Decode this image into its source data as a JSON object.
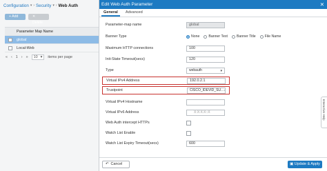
{
  "breadcrumb": {
    "items": [
      "Configuration",
      "Security",
      "Web Auth"
    ],
    "separator": "›"
  },
  "toolbar": {
    "add_label": "+ Add",
    "delete_label": "✕ Delete"
  },
  "table": {
    "header": "Parameter Map Name",
    "rows": [
      "global",
      "Local-Web"
    ]
  },
  "pager": {
    "first": "«",
    "prev": "‹",
    "page": "1",
    "next": "›",
    "last": "»",
    "per_page": "10",
    "per_page_suffix": "items per page"
  },
  "panel": {
    "title": "Edit Web Auth Parameter",
    "close_label": "✕",
    "tabs": [
      "General",
      "Advanced"
    ],
    "fields": {
      "param_map_name": {
        "label": "Parameter-map name",
        "value": "global"
      },
      "banner_type": {
        "label": "Banner Type",
        "options": [
          "None",
          "Banner Text",
          "Banner Title",
          "File Name"
        ],
        "selected": "None"
      },
      "max_http": {
        "label": "Maximum HTTP connections",
        "value": "100"
      },
      "init_state_timeout": {
        "label": "Init-State Timeout(secs)",
        "value": "120"
      },
      "type": {
        "label": "Type",
        "value": "webauth"
      },
      "virtual_ipv4": {
        "label": "Virtual IPv4 Address",
        "value": "192.0.2.1"
      },
      "trustpoint": {
        "label": "Trustpoint",
        "value": "CISCO_IDEVID_SU..."
      },
      "virtual_ipv4_hostname": {
        "label": "Virtual IPv4 Hostname",
        "value": ""
      },
      "virtual_ipv6": {
        "label": "Virtual IPv6 Address",
        "placeholder": "X:X:X:X::X"
      },
      "intercept_https": {
        "label": "Web Auth intercept HTTPs"
      },
      "watch_list_enable": {
        "label": "Watch List Enable"
      },
      "watch_list_expiry": {
        "label": "Watch List Expiry Timeout(secs)",
        "value": "600"
      }
    },
    "cancel_label": "Cancel",
    "apply_label": "Update & Apply"
  },
  "help_tab": {
    "label": "Interactive Help"
  },
  "colors": {
    "accent": "#1d7ac2",
    "highlight": "#c7312d",
    "selected_row": "#8dbbe6"
  }
}
